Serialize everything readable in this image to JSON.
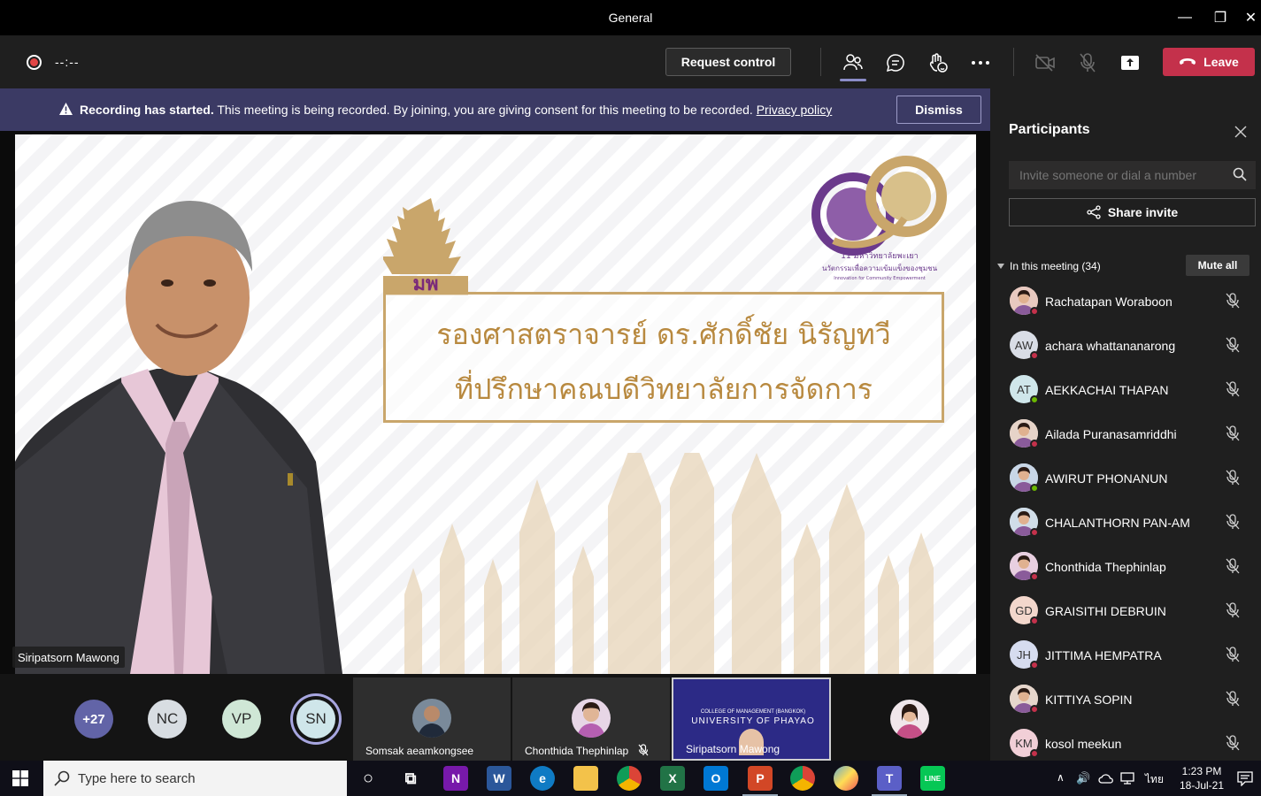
{
  "window": {
    "title": "General",
    "minimize_glyph": "—",
    "restore_glyph": "❐",
    "close_glyph": "✕"
  },
  "toolbar": {
    "timer": "--:--",
    "request_control_label": "Request control",
    "leave_label": "Leave",
    "icons": [
      "participants-icon",
      "chat-icon",
      "reactions-icon",
      "more-icon",
      "camera-off-icon",
      "mic-off-icon",
      "share-tray-icon",
      "phone-icon"
    ],
    "leave_color": "#c4314b",
    "accent": "#8b8cc7"
  },
  "banner": {
    "bold_text": "Recording has started.",
    "text": "This meeting is being recorded. By joining, you are giving consent for this meeting to be recorded.",
    "link_text": "Privacy policy",
    "dismiss_label": "Dismiss",
    "background": "#3b3a64"
  },
  "stage": {
    "slide_line1": "รองศาสตราจารย์ ดร.ศักดิ์ชัย นิรัญทวี",
    "slide_line2": "ที่ปรึกษาคณบดีวิทยาลัยการจัดการ",
    "crown_text": "มพ",
    "logo_text_1": "11 มหาวิทยาลัยพะเยา",
    "logo_text_2": "นวัตกรรมเพื่อความเข้มแข็งของชุมชน",
    "logo_text_3": "Innovation for Community Empowerment",
    "speaker_name": "Siripatsorn Mawong"
  },
  "strip": {
    "overflow_count": "+27",
    "avatars": [
      {
        "initials": "NC",
        "color": "#d8dde2"
      },
      {
        "initials": "VP",
        "color": "#cfe7d6"
      },
      {
        "initials": "SN",
        "color": "#cfe6ea"
      }
    ],
    "tiles": [
      {
        "name": "Somsak aeamkongsee"
      },
      {
        "name": "Chonthida Thephinlap"
      },
      {
        "name": "Siripatsorn Mawong"
      }
    ],
    "share_tile_text_1": "COLLEGE OF MANAGEMENT (BANGKOK)",
    "share_tile_text_2": "UNIVERSITY OF PHAYAO"
  },
  "panel": {
    "title": "Participants",
    "invite_placeholder": "Invite someone or dial a number",
    "share_invite_label": "Share invite",
    "in_meeting_label": "In this meeting (34)",
    "mute_all_label": "Mute all",
    "participants": [
      {
        "name": "Rachatapan Woraboon",
        "initials": "",
        "color": "#e8c9c0",
        "status": "#c4314b",
        "photo": true
      },
      {
        "name": "achara whattananarong",
        "initials": "AW",
        "color": "#d9dde6",
        "status": "#c4314b",
        "photo": false
      },
      {
        "name": "AEKKACHAI THAPAN",
        "initials": "AT",
        "color": "#cfe6ea",
        "status": "#6bb700",
        "photo": false
      },
      {
        "name": "Ailada Puranasamriddhi",
        "initials": "",
        "color": "#e6d3c8",
        "status": "#c4314b",
        "photo": true
      },
      {
        "name": "AWIRUT PHONANUN",
        "initials": "",
        "color": "#c8d6e6",
        "status": "#6bb700",
        "photo": true
      },
      {
        "name": "CHALANTHORN PAN-AM",
        "initials": "",
        "color": "#d0dde8",
        "status": "#c4314b",
        "photo": true
      },
      {
        "name": "Chonthida Thephinlap",
        "initials": "",
        "color": "#e8cfe0",
        "status": "#c4314b",
        "photo": true
      },
      {
        "name": "GRAISITHI DEBRUIN",
        "initials": "GD",
        "color": "#f3d7cc",
        "status": "#c4314b",
        "photo": false
      },
      {
        "name": "JITTIMA HEMPATRA",
        "initials": "JH",
        "color": "#d6dcef",
        "status": "#c4314b",
        "photo": false
      },
      {
        "name": "KITTIYA SOPIN",
        "initials": "",
        "color": "#e6d6cc",
        "status": "#c4314b",
        "photo": true
      },
      {
        "name": "kosol meekun",
        "initials": "KM",
        "color": "#f1cfd7",
        "status": "#c4314b",
        "photo": false
      }
    ]
  },
  "taskbar": {
    "search_placeholder": "Type here to search",
    "apps": [
      {
        "name": "cortana-icon",
        "label": "○"
      },
      {
        "name": "task-view-icon",
        "label": "⧉"
      },
      {
        "name": "onenote-icon",
        "label": "N"
      },
      {
        "name": "word-icon",
        "label": "W"
      },
      {
        "name": "edge-icon",
        "label": "e"
      },
      {
        "name": "file-explorer-icon",
        "label": ""
      },
      {
        "name": "chrome-icon",
        "label": ""
      },
      {
        "name": "excel-icon",
        "label": "X"
      },
      {
        "name": "outlook-icon",
        "label": "O"
      },
      {
        "name": "powerpoint-icon",
        "label": "P"
      },
      {
        "name": "chrome-icon-2",
        "label": ""
      },
      {
        "name": "paint-icon",
        "label": ""
      },
      {
        "name": "teams-icon",
        "label": "T"
      },
      {
        "name": "line-icon",
        "label": "LINE"
      }
    ],
    "tray_chevron": "∧",
    "tray_volume": "🔊",
    "language": "ไทย",
    "time": "1:23 PM",
    "date": "18-Jul-21"
  }
}
